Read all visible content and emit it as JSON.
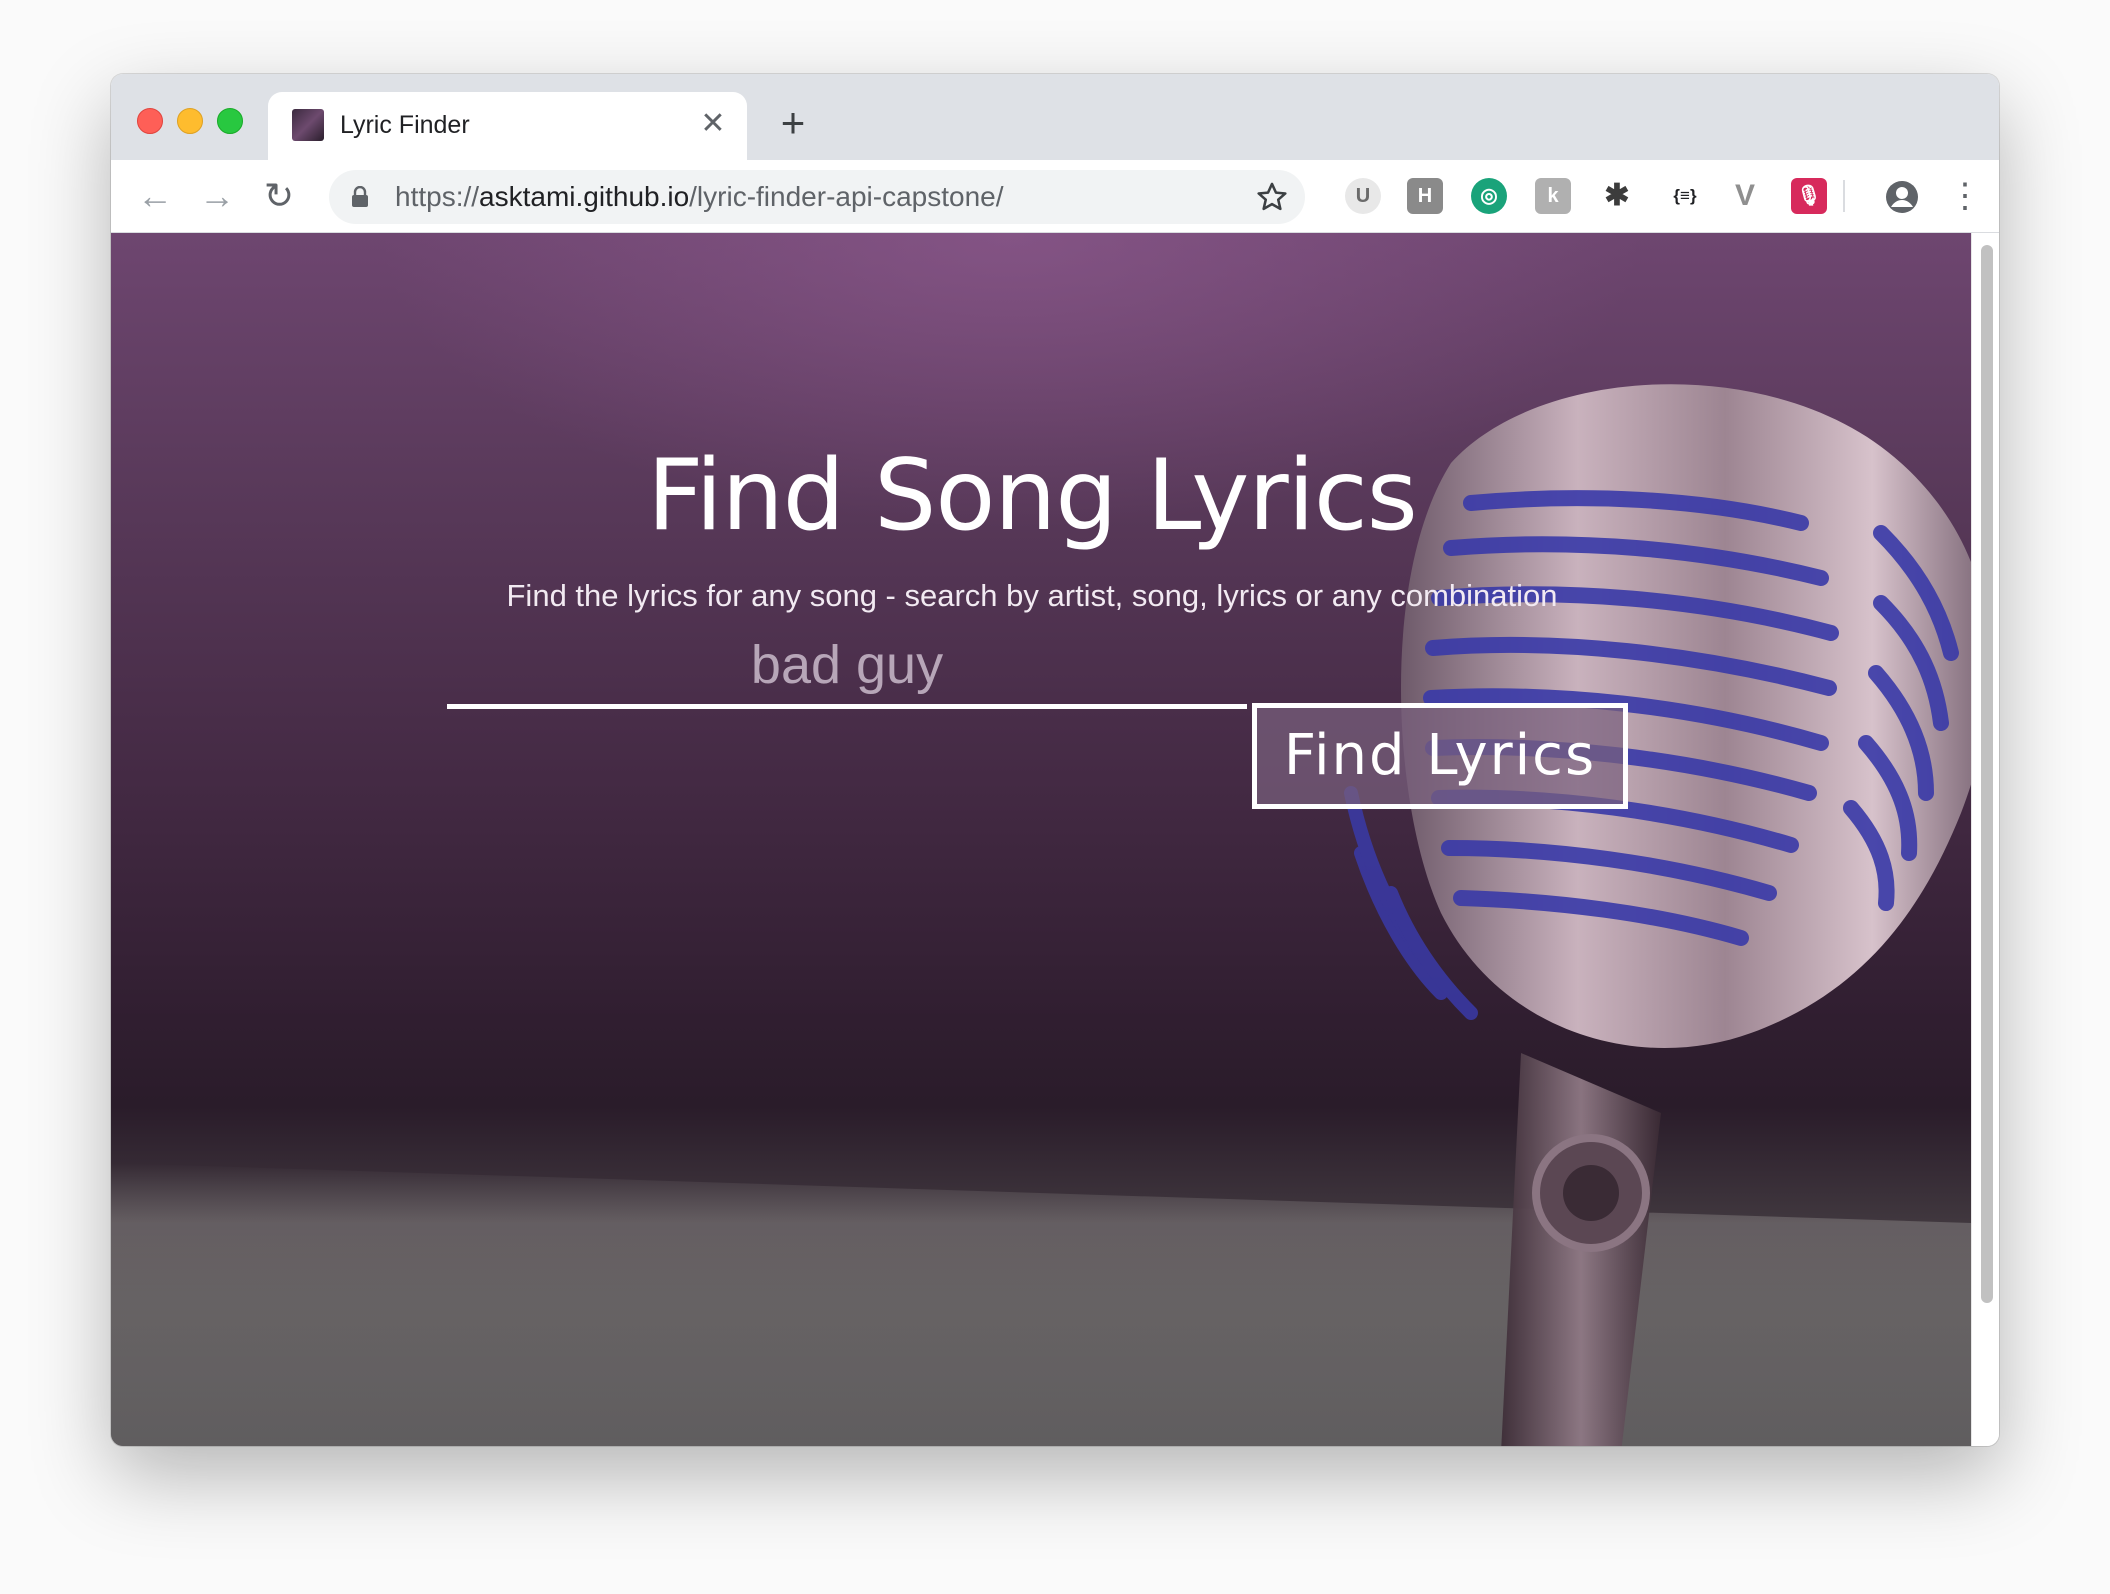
{
  "browser": {
    "tab": {
      "title": "Lyric Finder",
      "close_glyph": "✕",
      "favicon": "album-favicon"
    },
    "new_tab_glyph": "+",
    "address": {
      "scheme": "https://",
      "host": "asktami.github.io",
      "path": "/lyric-finder-api-capstone/"
    },
    "nav": {
      "back": "←",
      "forward": "→",
      "reload": "↻"
    },
    "extensions": [
      {
        "name": "ublock-icon",
        "glyph": "U"
      },
      {
        "name": "h-extension-icon",
        "glyph": "H"
      },
      {
        "name": "green-extension-icon",
        "glyph": "◎"
      },
      {
        "name": "k-extension-icon",
        "glyph": "k"
      },
      {
        "name": "gear-extension-icon",
        "glyph": "✱"
      },
      {
        "name": "json-extension-icon",
        "glyph": "{≡}"
      },
      {
        "name": "vue-extension-icon",
        "glyph": "V"
      },
      {
        "name": "mic-extension-icon",
        "glyph": "🎙"
      }
    ],
    "menu_glyph": "⋮",
    "colors": {
      "tabstrip": "#dee1e6",
      "omnibox": "#f1f3f4"
    }
  },
  "page": {
    "title": "Find Song Lyrics",
    "subtitle": "Find the lyrics for any song - search by artist, song, lyrics or any combination",
    "search": {
      "value": "bad guy",
      "placeholder": ""
    },
    "button_label": "Find Lyrics",
    "colors": {
      "background": "#4a2f4a",
      "accent": "#ffffff"
    }
  }
}
